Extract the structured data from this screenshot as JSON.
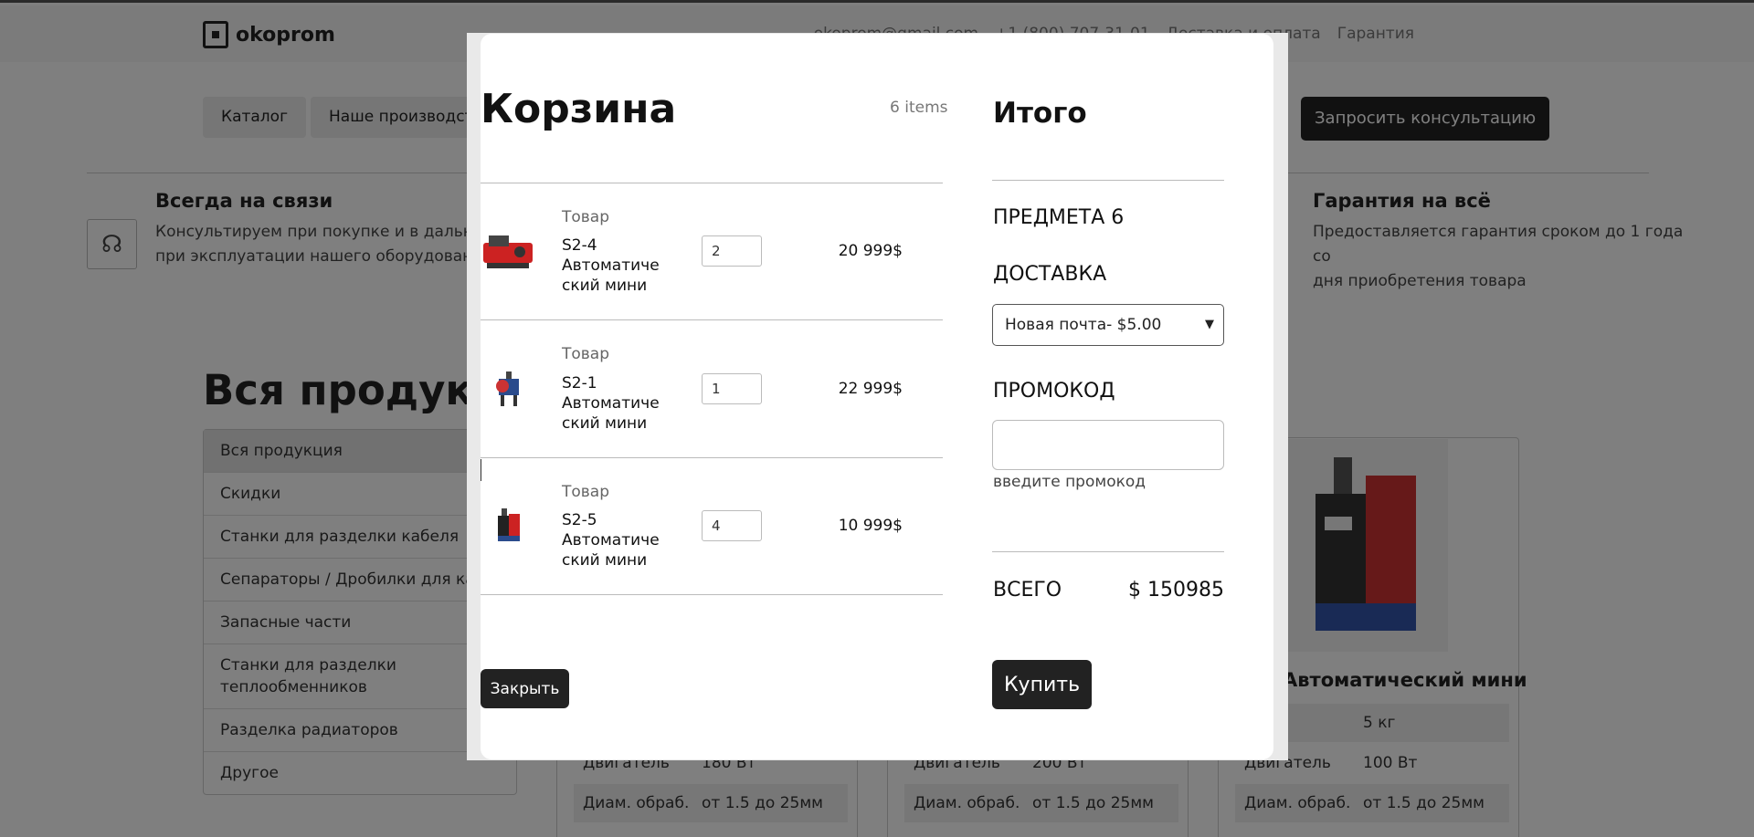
{
  "site": {
    "logo": "okoprom",
    "email": "okoprom@gmail.com",
    "phone": "+1 (800) 707-31-01",
    "links": [
      "Доставка и оплата",
      "Гарантия"
    ],
    "nav": [
      "Каталог",
      "Наше производство"
    ],
    "cta": "Запросить консультацию"
  },
  "features": {
    "left": {
      "title": "Всегда на связи",
      "line1": "Консультируем при покупке и в дальнейшем",
      "line2": "при эксплуатации нашего оборудования"
    },
    "right": {
      "title": "Гарантия на всё",
      "line1": "Предоставляется гарантия сроком до 1 года со",
      "line2": "дня приобретения товара"
    }
  },
  "catalog": {
    "title": "Вся продукция",
    "categories": [
      "Вся продукция",
      "Скидки",
      "Станки для разделки кабеля",
      "Сепараторы / Дробилки для кабеля",
      "Запасные части",
      "Станки для разделки теплообменников",
      "Разделка радиаторов",
      "Другое"
    ]
  },
  "cards": [
    {
      "specs": [
        [
          "Двигатель",
          "180 Вт"
        ],
        [
          "Диам. обраб.",
          "от 1.5 до 25мм"
        ]
      ]
    },
    {
      "specs": [
        [
          "Двигатель",
          "200 Вт"
        ],
        [
          "Диам. обраб.",
          "от 1.5 до 25мм"
        ]
      ]
    },
    {
      "title": "Автоматический мини",
      "specs": [
        [
          "",
          "5 кг"
        ],
        [
          "Двигатель",
          "100 Вт"
        ],
        [
          "Диам. обраб.",
          "от 1.5 до 25мм"
        ]
      ]
    }
  ],
  "cart": {
    "title": "Корзина",
    "count": "6 items",
    "item_label": "Товар",
    "items": [
      {
        "code": "S2-4",
        "name1": "Автоматиче",
        "name2": "ский мини",
        "qty": "2",
        "price": "20 999$"
      },
      {
        "code": "S2-1",
        "name1": "Автоматиче",
        "name2": "ский мини",
        "qty": "1",
        "price": "22 999$"
      },
      {
        "code": "S2-5",
        "name1": "Автоматиче",
        "name2": "ский мини",
        "qty": "4",
        "price": "10 999$"
      }
    ],
    "close_label": "Закрыть"
  },
  "summary": {
    "title": "Итого",
    "items_label": "ПРЕДМЕТА 6",
    "shipping_label": "ДОСТАВКА",
    "shipping_selected": "Новая почта- $5.00",
    "promo_label": "ПРОМОКОД",
    "promo_placeholder": "",
    "promo_hint": "введите промокод",
    "total_label": "ВСЕГО",
    "total_value": "$ 150985",
    "buy_label": "Купить"
  }
}
